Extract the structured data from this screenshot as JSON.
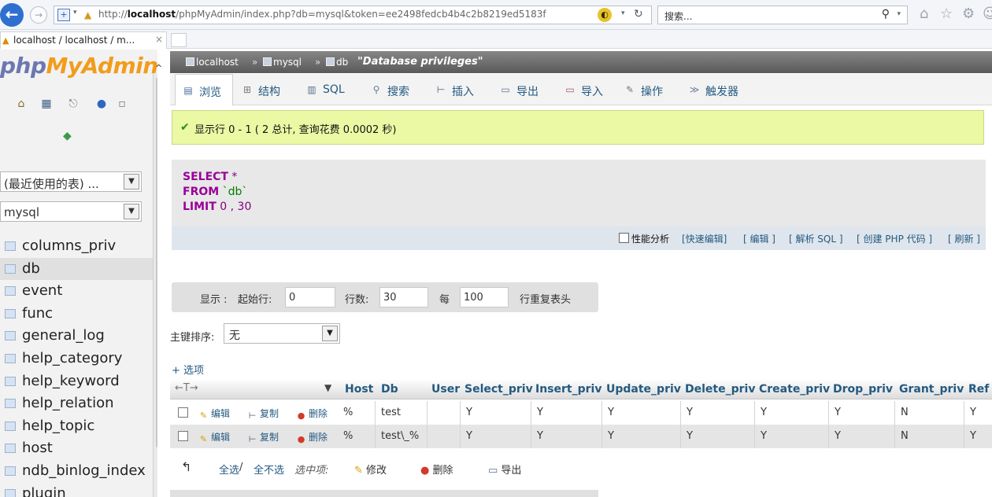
{
  "browser": {
    "url_prefix": "http://",
    "url_host": "localhost",
    "url_path": "/phpMyAdmin/index.php?db=mysql&token=ee2498fedcb4b4c2b8219ed5183f",
    "search_placeholder": "搜索...",
    "tab_title": "localhost / localhost / m..."
  },
  "logo": {
    "php": "php",
    "myadmin": "MyAdmin"
  },
  "nav": {
    "recent_select": "(最近使用的表) ...",
    "db_select": "mysql",
    "tables": [
      "columns_priv",
      "db",
      "event",
      "func",
      "general_log",
      "help_category",
      "help_keyword",
      "help_relation",
      "help_topic",
      "host",
      "ndb_binlog_index",
      "plugin"
    ]
  },
  "breadcrumb": {
    "server": "localhost",
    "database": "mysql",
    "table": "db",
    "title": "\"Database privileges\""
  },
  "menu": [
    "浏览",
    "结构",
    "SQL",
    "搜索",
    "插入",
    "导出",
    "导入",
    "操作",
    "触发器"
  ],
  "message": "显示行 0 - 1 ( 2 总计, 查询花费 0.0002 秒)",
  "sql": {
    "line1_kw": "SELECT",
    "line1_rest": " * ",
    "line2_kw": "FROM",
    "line2_rest": " `db` ",
    "line3_kw": "LIMIT",
    "line3_rest": " 0 , 30"
  },
  "sql_links": {
    "profiling": "性能分析",
    "inline_edit": "[快速编辑]",
    "edit": "[ 编辑 ]",
    "explain": "[ 解析 SQL ]",
    "create_php": "[ 创建 PHP 代码 ]",
    "refresh": "[ 刷新 ]"
  },
  "navigation": {
    "show_label": "显示 :",
    "start_label": "起始行:",
    "start_value": "0",
    "rows_label": "行数:",
    "rows_value": "30",
    "every_label": "每",
    "every_value": "100",
    "repeat_label": "行重复表头"
  },
  "sort": {
    "label": "主键排序:",
    "value": "无"
  },
  "options_link": "+ 选项",
  "table": {
    "arrows": "←T→",
    "columns": [
      "Host",
      "Db",
      "User",
      "Select_priv",
      "Insert_priv",
      "Update_priv",
      "Delete_priv",
      "Create_priv",
      "Drop_priv",
      "Grant_priv",
      "Ref"
    ],
    "actions": {
      "edit": "编辑",
      "copy": "复制",
      "delete": "删除"
    },
    "rows": [
      {
        "host": "%",
        "db": "test",
        "user": "",
        "select": "Y",
        "insert": "Y",
        "update": "Y",
        "delete": "Y",
        "create": "Y",
        "drop": "Y",
        "grant": "N",
        "ref": "Y"
      },
      {
        "host": "%",
        "db": "test\\_%",
        "user": "",
        "select": "Y",
        "insert": "Y",
        "update": "Y",
        "delete": "Y",
        "create": "Y",
        "drop": "Y",
        "grant": "N",
        "ref": "Y"
      }
    ]
  },
  "bulk": {
    "check_all": "全选",
    "sep": " / ",
    "uncheck_all": "全不选",
    "with_selected": "选中项:",
    "change": "修改",
    "delete": "删除",
    "export": "导出"
  }
}
